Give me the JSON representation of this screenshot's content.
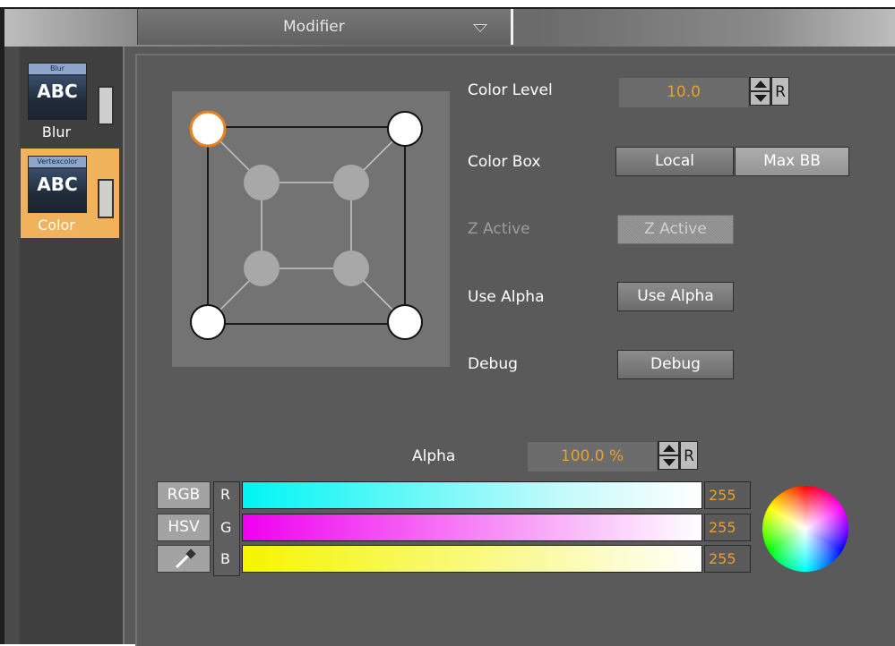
{
  "header": {
    "dropdown_label": "Modifier"
  },
  "sidebar": {
    "items": [
      {
        "thumb_title": "Blur",
        "thumb_text": "ABC",
        "label": "Blur",
        "selected": false
      },
      {
        "thumb_title": "Vertexcolor",
        "thumb_text": "ABC",
        "label": "Color",
        "selected": true
      }
    ]
  },
  "props": {
    "color_level": {
      "label": "Color Level",
      "value": "10.0",
      "reset": "R"
    },
    "color_box": {
      "label": "Color Box",
      "options": [
        "Local",
        "Max BB"
      ]
    },
    "z_active": {
      "label": "Z Active",
      "button": "Z Active"
    },
    "use_alpha": {
      "label": "Use Alpha",
      "button": "Use Alpha"
    },
    "debug": {
      "label": "Debug",
      "button": "Debug"
    }
  },
  "color": {
    "alpha_label": "Alpha",
    "alpha_value": "100.0 %",
    "alpha_reset": "R",
    "modes": [
      "RGB",
      "HSV"
    ],
    "channels": [
      {
        "name": "R",
        "value": "255"
      },
      {
        "name": "G",
        "value": "255"
      },
      {
        "name": "B",
        "value": "255"
      }
    ]
  },
  "colors": {
    "accent": "#e8a02a",
    "selected_item": "#f0b25a",
    "panel": "#595959"
  }
}
